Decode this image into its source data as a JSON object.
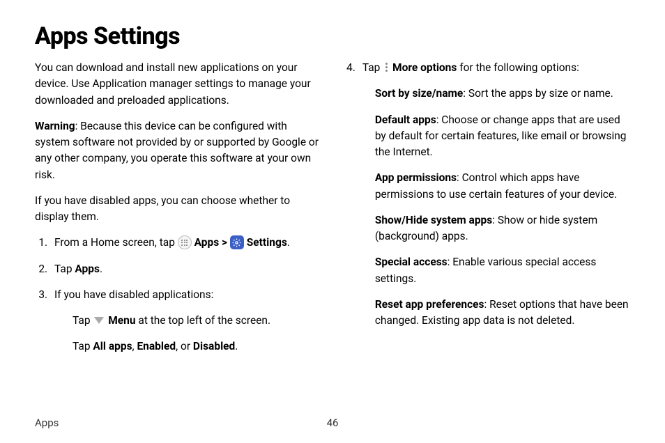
{
  "title": "Apps Settings",
  "leftCol": {
    "intro": "You can download and install new applications on your device. Use Application manager settings to manage your downloaded and preloaded applications.",
    "warningLabel": "Warning",
    "warningText": ": Because this device can be configured with system software not provided by or supported by Google or any other company, you operate this software at your own risk.",
    "disabledNote": "If you have disabled apps, you can choose whether to display them.",
    "step1_prefix": "From a Home screen, tap ",
    "step1_apps": "Apps",
    "step1_sep": " > ",
    "step1_settings": "Settings",
    "step1_end": ".",
    "step2_prefix": "Tap ",
    "step2_bold": "Apps",
    "step2_end": ".",
    "step3": "If you have disabled applications:",
    "step3a_prefix": "Tap ",
    "step3a_bold": "Menu",
    "step3a_rest": " at the top left of the screen.",
    "step3b_prefix": "Tap ",
    "step3b_b1": "All apps",
    "step3b_c1": ", ",
    "step3b_b2": "Enabled",
    "step3b_c2": ", or ",
    "step3b_b3": "Disabled",
    "step3b_end": "."
  },
  "rightCol": {
    "step4_marker": "4.",
    "step4_prefix": "Tap ",
    "step4_bold": "More options",
    "step4_rest": " for the following options:",
    "opts": {
      "sort_b": "Sort by size/name",
      "sort_r": ": Sort the apps by size or name.",
      "default_b": "Default apps",
      "default_r": ": Choose or change apps that are used by default for certain features, like email or browsing the Internet.",
      "perm_b": "App permissions",
      "perm_r": ": Control which apps have permissions to use certain features of your device.",
      "show_b": "Show/Hide system apps",
      "show_r": ": Show or hide system (background) apps.",
      "special_b": "Special access",
      "special_r": ": Enable various special access settings.",
      "reset_b": "Reset app preferences",
      "reset_r": ": Reset options that have been changed. Existing app data is not deleted."
    }
  },
  "footer": {
    "section": "Apps",
    "page": "46"
  }
}
